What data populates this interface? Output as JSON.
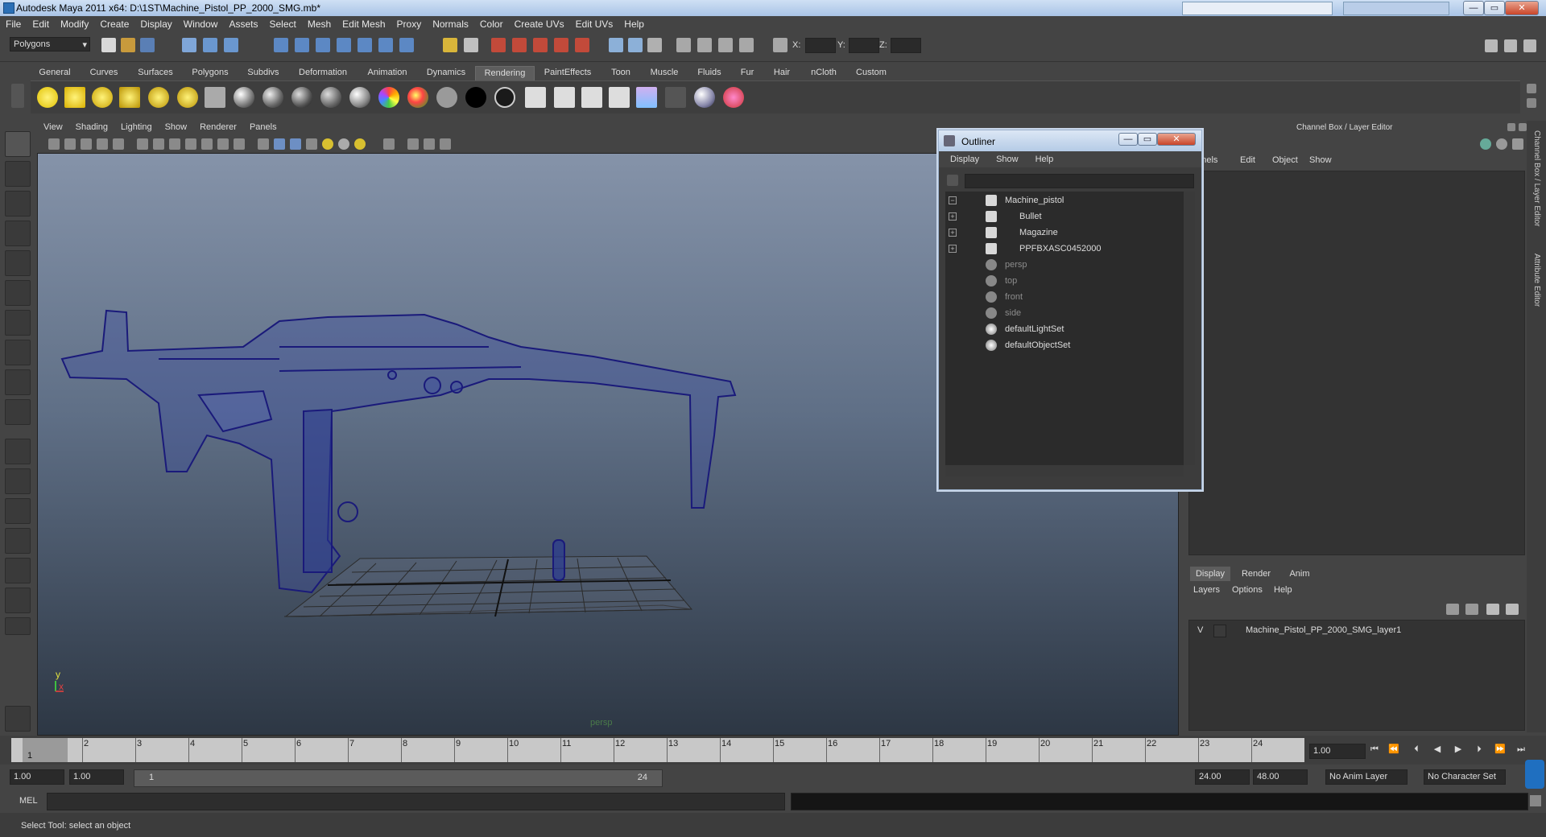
{
  "window": {
    "title": "Autodesk Maya 2011 x64: D:\\1ST\\Machine_Pistol_PP_2000_SMG.mb*",
    "btn_min": "—",
    "btn_max": "▭",
    "btn_close": "✕"
  },
  "menubar": [
    "File",
    "Edit",
    "Modify",
    "Create",
    "Display",
    "Window",
    "Assets",
    "Select",
    "Mesh",
    "Edit Mesh",
    "Proxy",
    "Normals",
    "Color",
    "Create UVs",
    "Edit UVs",
    "Help"
  ],
  "status": {
    "mode": "Polygons",
    "x_label": "X:",
    "y_label": "Y:",
    "z_label": "Z:"
  },
  "shelf_tabs": [
    "General",
    "Curves",
    "Surfaces",
    "Polygons",
    "Subdivs",
    "Deformation",
    "Animation",
    "Dynamics",
    "Rendering",
    "PaintEffects",
    "Toon",
    "Muscle",
    "Fluids",
    "Fur",
    "Hair",
    "nCloth",
    "Custom"
  ],
  "active_shelf_tab": "Rendering",
  "viewport": {
    "menu": [
      "View",
      "Shading",
      "Lighting",
      "Show",
      "Renderer",
      "Panels"
    ],
    "camera_label": "persp",
    "axis_y": "y",
    "axis_x": "x",
    "wire_color": "#1a1a7a"
  },
  "outliner": {
    "title": "Outliner",
    "menu": [
      "Display",
      "Show",
      "Help"
    ],
    "items": [
      {
        "label": "Machine_pistol",
        "expander": "−",
        "dim": false
      },
      {
        "label": "Bullet",
        "expander": "+",
        "dim": false
      },
      {
        "label": "Magazine",
        "expander": "+",
        "dim": false
      },
      {
        "label": "PPFBXASC0452000",
        "expander": "+",
        "dim": false
      },
      {
        "label": "persp",
        "expander": "",
        "dim": true
      },
      {
        "label": "top",
        "expander": "",
        "dim": true
      },
      {
        "label": "front",
        "expander": "",
        "dim": true
      },
      {
        "label": "side",
        "expander": "",
        "dim": true
      },
      {
        "label": "defaultLightSet",
        "expander": "",
        "dim": false
      },
      {
        "label": "defaultObjectSet",
        "expander": "",
        "dim": false
      }
    ]
  },
  "channel_box": {
    "title": "Channel Box / Layer Editor",
    "menu": [
      "annels",
      "Edit",
      "Object",
      "Show"
    ],
    "side_tab_1": "Channel Box / Layer Editor",
    "side_tab_2": "Attribute Editor"
  },
  "layer_editor": {
    "tabs": [
      "Display",
      "Render",
      "Anim"
    ],
    "active_tab": "Display",
    "menu": [
      "Layers",
      "Options",
      "Help"
    ],
    "layer_visibility": "V",
    "layer_name": "Machine_Pistol_PP_2000_SMG_layer1"
  },
  "timeline": {
    "ticks": [
      "1",
      "2",
      "3",
      "4",
      "5",
      "6",
      "7",
      "8",
      "9",
      "10",
      "11",
      "12",
      "13",
      "14",
      "15",
      "16",
      "17",
      "18",
      "19",
      "20",
      "21",
      "22",
      "23",
      "24"
    ],
    "current_frame_marker": "1",
    "current_time": "1.00"
  },
  "range": {
    "start_time": "1.00",
    "playback_start": "1.00",
    "slider_start": "1",
    "slider_end": "24",
    "playback_end": "24.00",
    "end_time": "48.00",
    "anim_layer": "No Anim Layer",
    "character_set": "No Character Set"
  },
  "command": {
    "label": "MEL"
  },
  "help_line": "Select Tool: select an object"
}
